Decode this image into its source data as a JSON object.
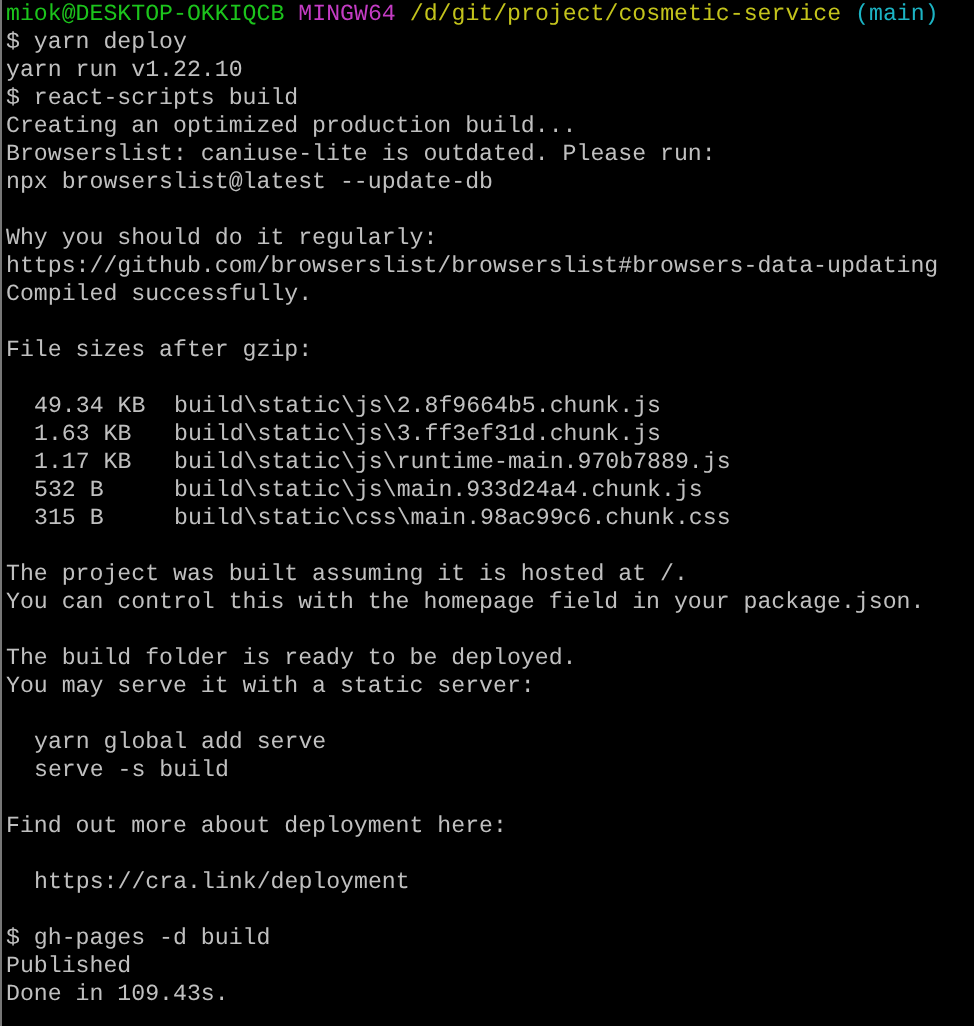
{
  "terminal": {
    "lines": [
      {
        "kind": "prompt",
        "segments": [
          {
            "text": "miok@DESKTOP-OKKIQCB",
            "color": "#1cc41c"
          },
          {
            "text": "MINGW64",
            "color": "#c43cc4"
          },
          {
            "text": "/d/git/project/cosmetic-service",
            "color": "#c4c41c"
          },
          {
            "text": "(main)",
            "color": "#1cb4c4"
          }
        ]
      },
      {
        "kind": "text",
        "text": "$ yarn deploy"
      },
      {
        "kind": "text",
        "text": "yarn run v1.22.10"
      },
      {
        "kind": "text",
        "text": "$ react-scripts build"
      },
      {
        "kind": "text",
        "text": "Creating an optimized production build..."
      },
      {
        "kind": "text",
        "text": "Browserslist: caniuse-lite is outdated. Please run:"
      },
      {
        "kind": "text",
        "text": "npx browserslist@latest --update-db"
      },
      {
        "kind": "blank"
      },
      {
        "kind": "text",
        "text": "Why you should do it regularly:"
      },
      {
        "kind": "text",
        "text": "https://github.com/browserslist/browserslist#browsers-data-updating"
      },
      {
        "kind": "text",
        "text": "Compiled successfully."
      },
      {
        "kind": "blank"
      },
      {
        "kind": "text",
        "text": "File sizes after gzip:"
      },
      {
        "kind": "blank"
      },
      {
        "kind": "file",
        "size": "49.34 KB",
        "path": "build\\static\\js\\2.8f9664b5.chunk.js"
      },
      {
        "kind": "file",
        "size": "1.63 KB",
        "path": "build\\static\\js\\3.ff3ef31d.chunk.js"
      },
      {
        "kind": "file",
        "size": "1.17 KB",
        "path": "build\\static\\js\\runtime-main.970b7889.js"
      },
      {
        "kind": "file",
        "size": "532 B",
        "path": "build\\static\\js\\main.933d24a4.chunk.js"
      },
      {
        "kind": "file",
        "size": "315 B",
        "path": "build\\static\\css\\main.98ac99c6.chunk.css"
      },
      {
        "kind": "blank"
      },
      {
        "kind": "text",
        "text": "The project was built assuming it is hosted at /."
      },
      {
        "kind": "text",
        "text": "You can control this with the homepage field in your package.json."
      },
      {
        "kind": "blank"
      },
      {
        "kind": "text",
        "text": "The build folder is ready to be deployed."
      },
      {
        "kind": "text",
        "text": "You may serve it with a static server:"
      },
      {
        "kind": "blank"
      },
      {
        "kind": "indent",
        "text": "yarn global add serve"
      },
      {
        "kind": "indent",
        "text": "serve -s build"
      },
      {
        "kind": "blank"
      },
      {
        "kind": "text",
        "text": "Find out more about deployment here:"
      },
      {
        "kind": "blank"
      },
      {
        "kind": "indent",
        "text": "https://cra.link/deployment"
      },
      {
        "kind": "blank"
      },
      {
        "kind": "text",
        "text": "$ gh-pages -d build"
      },
      {
        "kind": "text",
        "text": "Published"
      },
      {
        "kind": "text",
        "text": "Done in 109.43s."
      }
    ]
  }
}
